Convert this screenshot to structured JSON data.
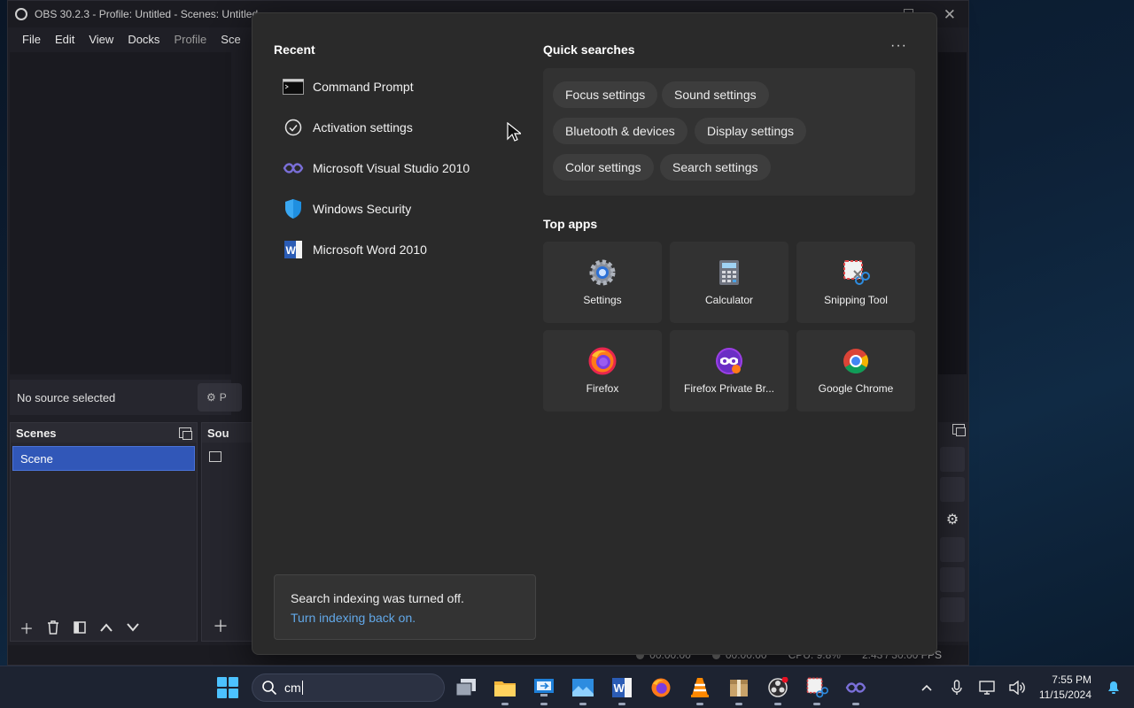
{
  "obs": {
    "title": "OBS 30.2.3 - Profile: Untitled - Scenes: Untitled",
    "menu": [
      "File",
      "Edit",
      "View",
      "Docks",
      "Profile",
      "Sce"
    ],
    "status_text": "No source selected",
    "properties_btn": "P",
    "scenes_header": "Scenes",
    "scene_item": "Scene",
    "sources_header": "Sou",
    "footer": {
      "rec_time": "00:00:00",
      "stream_time": "00:00:00",
      "cpu": "CPU: 9.8%",
      "fps": "2.43 / 30.00 FPS"
    }
  },
  "search": {
    "recent_title": "Recent",
    "recent": [
      {
        "label": "Command Prompt",
        "icon": "cmd-icon"
      },
      {
        "label": "Activation settings",
        "icon": "check-circle-icon"
      },
      {
        "label": "Microsoft Visual Studio 2010",
        "icon": "visual-studio-icon"
      },
      {
        "label": "Windows Security",
        "icon": "shield-icon"
      },
      {
        "label": "Microsoft Word 2010",
        "icon": "word-icon"
      }
    ],
    "quick_title": "Quick searches",
    "more": "···",
    "quick": [
      "Focus settings",
      "Sound settings",
      "Bluetooth & devices",
      "Display settings",
      "Color settings",
      "Search settings"
    ],
    "top_title": "Top apps",
    "apps": [
      {
        "label": "Settings",
        "icon": "settings-gear-icon"
      },
      {
        "label": "Calculator",
        "icon": "calculator-icon"
      },
      {
        "label": "Snipping Tool",
        "icon": "snipping-tool-icon"
      },
      {
        "label": "Firefox",
        "icon": "firefox-icon"
      },
      {
        "label": "Firefox Private Br...",
        "icon": "firefox-private-icon"
      },
      {
        "label": "Google Chrome",
        "icon": "chrome-icon"
      }
    ],
    "index_msg": "Search indexing was turned off.",
    "index_link": "Turn indexing back on."
  },
  "taskbar": {
    "search_value": "cm",
    "time": "7:55 PM",
    "date": "11/15/2024"
  },
  "colors": {
    "accent": "#4cc2ff",
    "link": "#62a8e8",
    "scene_selected": "#3157b8"
  }
}
